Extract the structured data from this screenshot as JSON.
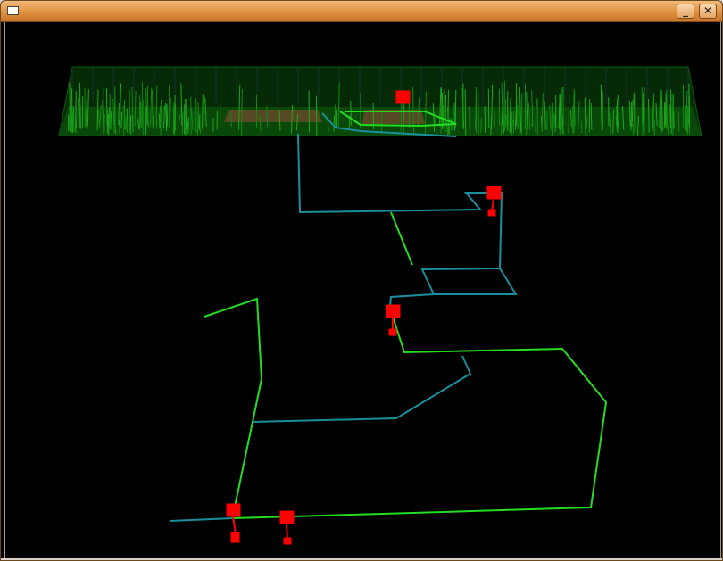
{
  "window": {
    "title": "",
    "app_icon": "window-icon",
    "minimize_icon": "minimize-icon",
    "close_icon": "close-icon",
    "minimize_glyph": "_",
    "close_glyph": "✕"
  },
  "scene": {
    "background": "#000000",
    "colors": {
      "grid_plane": "#0a5c0a",
      "grass": "#1fa81f",
      "route_green": "#22dd22",
      "route_teal": "#1a8f9c",
      "marker": "#ff0000",
      "floor_tile": "#6a4a2a"
    }
  }
}
